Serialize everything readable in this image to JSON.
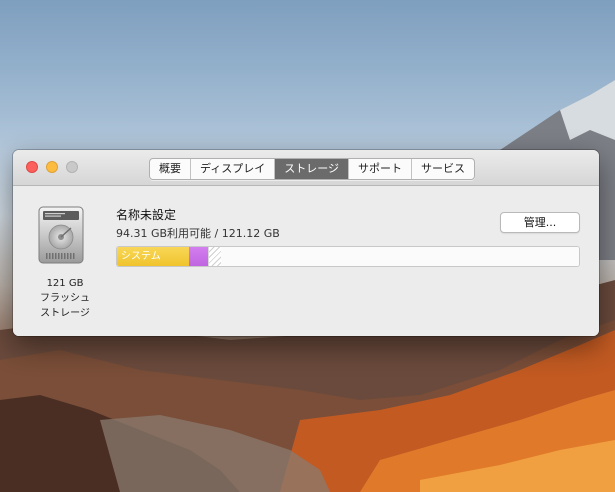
{
  "window": {
    "tabs": [
      {
        "label": "概要",
        "active": false
      },
      {
        "label": "ディスプレイ",
        "active": false
      },
      {
        "label": "ストレージ",
        "active": true
      },
      {
        "label": "サポート",
        "active": false
      },
      {
        "label": "サービス",
        "active": false
      }
    ]
  },
  "disk": {
    "icon": "hard-drive-icon",
    "size": "121 GB",
    "type_line1": "フラッシュ",
    "type_line2": "ストレージ"
  },
  "drive": {
    "name": "名称未設定",
    "available": "94.31 GB利用可能 / 121.12 GB",
    "manage_label": "管理..."
  },
  "storage_bar": {
    "segments": [
      {
        "name": "system",
        "label": "システム",
        "color": "#f3c935",
        "fraction": 0.156
      },
      {
        "name": "other",
        "label": "",
        "color": "#c86ee6",
        "fraction": 0.041
      },
      {
        "name": "purgeable",
        "label": "",
        "color": "#d0d0d0",
        "fraction": 0.026
      }
    ]
  },
  "colors": {
    "close": "#fc605c",
    "minimize": "#fdbc40",
    "zoom": "#c9c9c9",
    "active_tab": "#6b6b6b"
  }
}
